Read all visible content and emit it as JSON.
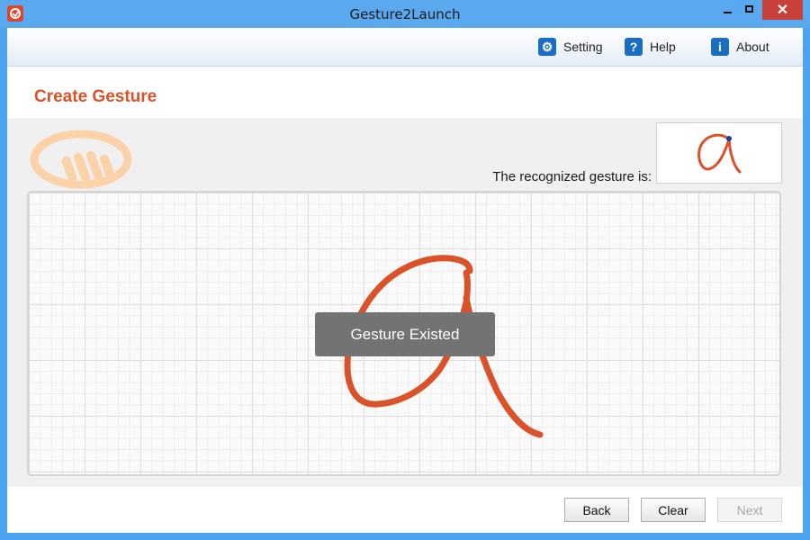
{
  "window": {
    "title": "Gesture2Launch",
    "close_glyph": "✕"
  },
  "toolbar": {
    "setting": {
      "label": "Setting",
      "icon": "gear-icon",
      "glyph": "⚙"
    },
    "help": {
      "label": "Help",
      "icon": "question-icon",
      "glyph": "?"
    },
    "about": {
      "label": "About",
      "icon": "info-icon",
      "glyph": "i"
    }
  },
  "page": {
    "title": "Create Gesture"
  },
  "recognition": {
    "label": "The recognized gesture is:"
  },
  "toast": {
    "message": "Gesture Existed"
  },
  "buttons": {
    "back": "Back",
    "clear": "Clear",
    "next": "Next"
  },
  "colors": {
    "accent": "#d9522a",
    "stroke": "#d9522a",
    "titlebar": "#5aa8ee",
    "close": "#c7413a"
  }
}
